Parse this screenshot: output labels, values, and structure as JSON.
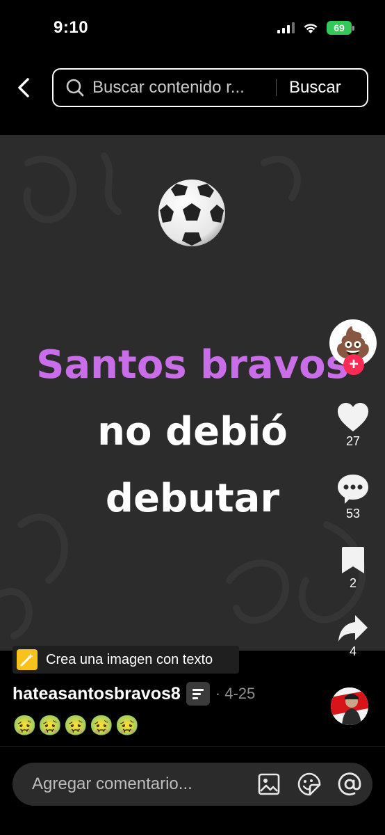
{
  "status_bar": {
    "time": "9:10",
    "battery": "69"
  },
  "search": {
    "query": "Buscar contenido r...",
    "button_label": "Buscar"
  },
  "video": {
    "emoji_main": "⚽",
    "headline_line1": "Santos bravos",
    "headline_line2": "no debió",
    "headline_line3": "debutar",
    "headline_accent_color": "#c96ee8"
  },
  "actions": {
    "creator_avatar_emoji": "💩",
    "follow_label": "+",
    "likes": "27",
    "comments": "53",
    "saves": "2",
    "shares": "4"
  },
  "create_chip": {
    "label": "Crea una imagen con texto"
  },
  "post": {
    "author": "hateasantosbravos8",
    "date": "· 4-25",
    "caption": "🤢🤢🤢🤢🤢"
  },
  "comment_bar": {
    "placeholder": "Agregar comentario..."
  },
  "colors": {
    "like_red": "#fe2c55",
    "battery_green": "#34c759",
    "chip_icon_yellow": "#f7c21a"
  }
}
